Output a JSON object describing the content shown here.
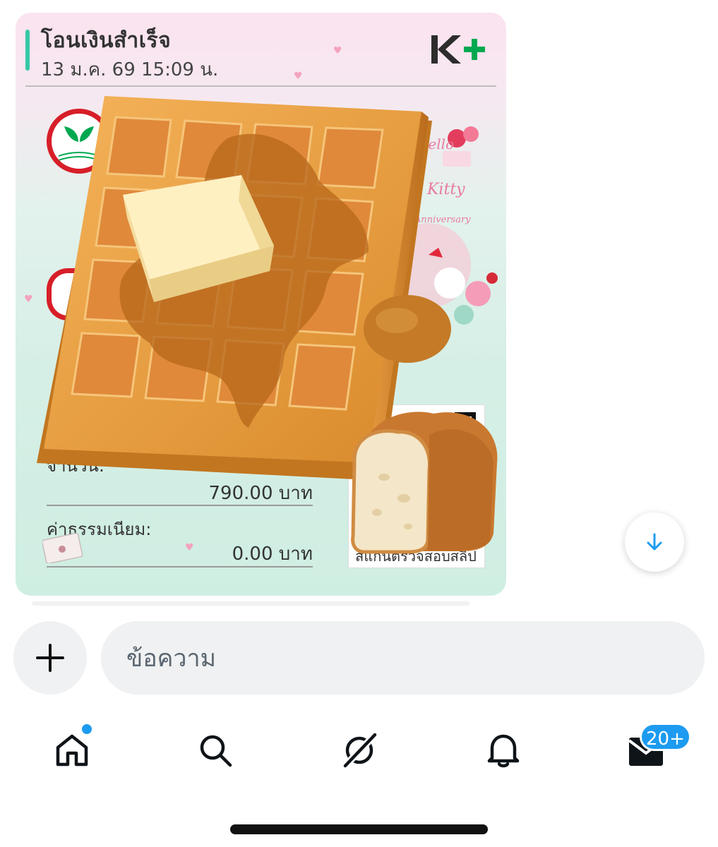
{
  "slip": {
    "title": "โอนเงินสำเร็จ",
    "datetime": "13 ม.ค. 69  15:09 น.",
    "amount_label": "จำนวน:",
    "amount_value": "790.00 บาท",
    "fee_label": "ค่าธรรมเนียม:",
    "fee_value": "0.00 บาท",
    "qr_caption": "สแกนตรวจสอบสลิป",
    "deco_text": [
      "Hello",
      "Kitty",
      "Anniversary"
    ]
  },
  "composer": {
    "placeholder": "ข้อความ"
  },
  "tabs": [
    {
      "name": "home-icon"
    },
    {
      "name": "search-icon"
    },
    {
      "name": "grok-icon"
    },
    {
      "name": "bell-icon"
    },
    {
      "name": "mail-icon"
    }
  ],
  "badges": {
    "messages": "20+"
  },
  "colors": {
    "accent": "#1d9bf0",
    "kbank_green": "#00a950",
    "kbank_red": "#d71e28",
    "slip_accent": "#36c9a6"
  }
}
